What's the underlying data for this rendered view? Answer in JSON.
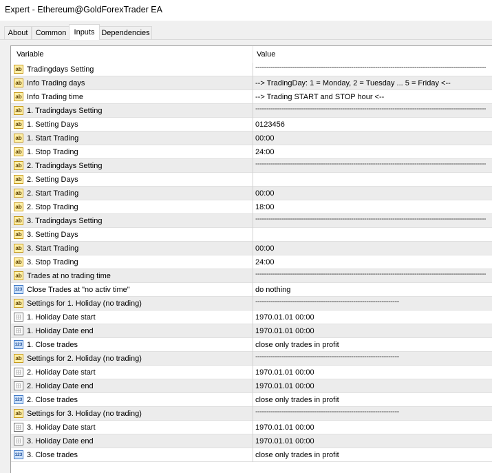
{
  "window": {
    "title": "Expert - Ethereum@GoldForexTrader EA"
  },
  "tabs": [
    {
      "label": "About",
      "active": false
    },
    {
      "label": "Common",
      "active": false
    },
    {
      "label": "Inputs",
      "active": true
    },
    {
      "label": "Dependencies",
      "active": false
    }
  ],
  "table": {
    "header": {
      "variable": "Variable",
      "value": "Value"
    },
    "rows": [
      {
        "icon": "ab",
        "name": "Tradingdays Setting",
        "value": "----------------------------------------------------------------------------------------------------------"
      },
      {
        "icon": "ab",
        "name": "Info Trading days",
        "value": "-->  TradingDay: 1 = Monday, 2 = Tuesday ... 5 = Friday <--"
      },
      {
        "icon": "ab",
        "name": "Info Trading time",
        "value": "-->  Trading START and STOP hour  <--"
      },
      {
        "icon": "ab",
        "name": "1. Tradingdays Setting",
        "value": "----------------------------------------------------------------------------------------------------------"
      },
      {
        "icon": "ab",
        "name": "1. Setting Days",
        "value": "0123456"
      },
      {
        "icon": "ab",
        "name": "1. Start Trading",
        "value": "00:00"
      },
      {
        "icon": "ab",
        "name": "1. Stop Trading",
        "value": "24:00"
      },
      {
        "icon": "ab",
        "name": "2. Tradingdays Setting",
        "value": "----------------------------------------------------------------------------------------------------------"
      },
      {
        "icon": "ab",
        "name": "2. Setting Days",
        "value": ""
      },
      {
        "icon": "ab",
        "name": "2. Start Trading",
        "value": "00:00"
      },
      {
        "icon": "ab",
        "name": "2. Stop Trading",
        "value": "18:00"
      },
      {
        "icon": "ab",
        "name": "3. Tradingdays Setting",
        "value": "----------------------------------------------------------------------------------------------------------"
      },
      {
        "icon": "ab",
        "name": "3. Setting Days",
        "value": ""
      },
      {
        "icon": "ab",
        "name": "3. Start Trading",
        "value": "00:00"
      },
      {
        "icon": "ab",
        "name": "3. Stop Trading",
        "value": "24:00"
      },
      {
        "icon": "ab",
        "name": "Trades at no trading time",
        "value": "----------------------------------------------------------------------------------------------------------"
      },
      {
        "icon": "123",
        "name": "Close Trades at \"no activ time\"",
        "value": "do nothing"
      },
      {
        "icon": "ab",
        "name": "Settings for 1. Holiday (no trading)",
        "value": "------------------------------------------------------------------"
      },
      {
        "icon": "calendar",
        "name": "1. Holiday Date start",
        "value": "1970.01.01 00:00"
      },
      {
        "icon": "calendar",
        "name": "1. Holiday Date end",
        "value": "1970.01.01 00:00"
      },
      {
        "icon": "123",
        "name": "1. Close trades",
        "value": "close only trades in profit"
      },
      {
        "icon": "ab",
        "name": "Settings for 2. Holiday (no trading)",
        "value": "------------------------------------------------------------------"
      },
      {
        "icon": "calendar",
        "name": "2. Holiday Date start",
        "value": "1970.01.01 00:00"
      },
      {
        "icon": "calendar",
        "name": "2. Holiday Date end",
        "value": "1970.01.01 00:00"
      },
      {
        "icon": "123",
        "name": "2. Close trades",
        "value": "close only trades in profit"
      },
      {
        "icon": "ab",
        "name": "Settings for 3. Holiday (no trading)",
        "value": "------------------------------------------------------------------"
      },
      {
        "icon": "calendar",
        "name": "3. Holiday Date start",
        "value": "1970.01.01 00:00"
      },
      {
        "icon": "calendar",
        "name": "3. Holiday Date end",
        "value": "1970.01.01 00:00"
      },
      {
        "icon": "123",
        "name": "3. Close trades",
        "value": "close only trades in profit"
      }
    ]
  }
}
